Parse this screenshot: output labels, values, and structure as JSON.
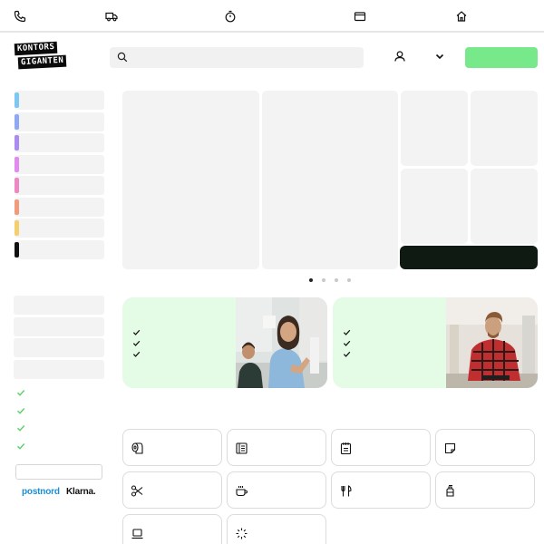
{
  "brand": {
    "logo_line1": "KONTORS",
    "logo_line2": "GIGANTEN"
  },
  "topbar": {
    "icons": [
      "phone-icon",
      "truck-icon",
      "stopwatch-icon",
      "wallet-icon",
      "home-icon"
    ]
  },
  "header": {
    "search_placeholder": "",
    "icons": [
      "search-icon",
      "user-icon",
      "chevron-down-icon"
    ]
  },
  "sidebar": {
    "category_colors": [
      "#7cc8f2",
      "#8ea8f3",
      "#a98bf2",
      "#e38af0",
      "#ef87c2",
      "#f29b7c",
      "#f4cf6e",
      "#111111"
    ],
    "payment_partners": {
      "postnord": "postnord",
      "klarna": "Klarna."
    }
  },
  "hero": {
    "carousel_dots": 4,
    "active_dot": 0
  },
  "colors": {
    "accent_green": "#77e98a",
    "promo_green": "#e4fbe6",
    "dark_button": "#0e1a12"
  },
  "product_categories": [
    {
      "icon": "toilet-paper-icon"
    },
    {
      "icon": "binder-icon"
    },
    {
      "icon": "notepad-icon"
    },
    {
      "icon": "sticky-note-icon"
    },
    {
      "icon": "scissors-icon"
    },
    {
      "icon": "coffee-cup-icon"
    },
    {
      "icon": "cutlery-icon"
    },
    {
      "icon": "cleaning-bottle-icon"
    },
    {
      "icon": "laptop-icon"
    },
    {
      "icon": "loading-spinner-icon"
    }
  ]
}
